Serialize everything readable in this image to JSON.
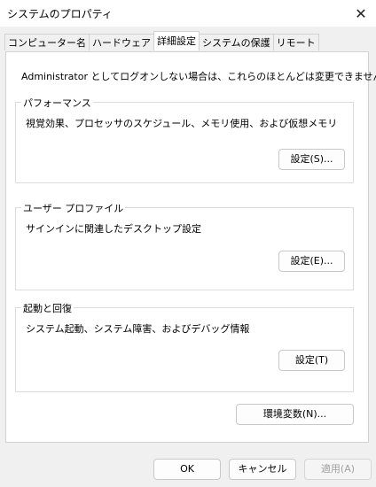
{
  "window": {
    "title": "システムのプロパティ",
    "close_icon": "close-icon"
  },
  "tabs": [
    {
      "label": "コンピューター名",
      "active": false
    },
    {
      "label": "ハードウェア",
      "active": false
    },
    {
      "label": "詳細設定",
      "active": true
    },
    {
      "label": "システムの保護",
      "active": false
    },
    {
      "label": "リモート",
      "active": false
    }
  ],
  "main": {
    "intro": "Administrator としてログオンしない場合は、これらのほとんどは変更できません。",
    "performance": {
      "title": "パフォーマンス",
      "description": "視覚効果、プロセッサのスケジュール、メモリ使用、および仮想メモリ",
      "button": "設定(S)..."
    },
    "user_profile": {
      "title": "ユーザー プロファイル",
      "description": "サインインに関連したデスクトップ設定",
      "button": "設定(E)..."
    },
    "startup": {
      "title": "起動と回復",
      "description": "システム起動、システム障害、およびデバッグ情報",
      "button": "設定(T)"
    },
    "env_button": "環境変数(N)..."
  },
  "footer": {
    "ok": "OK",
    "cancel": "キャンセル",
    "apply": "適用(A)"
  }
}
